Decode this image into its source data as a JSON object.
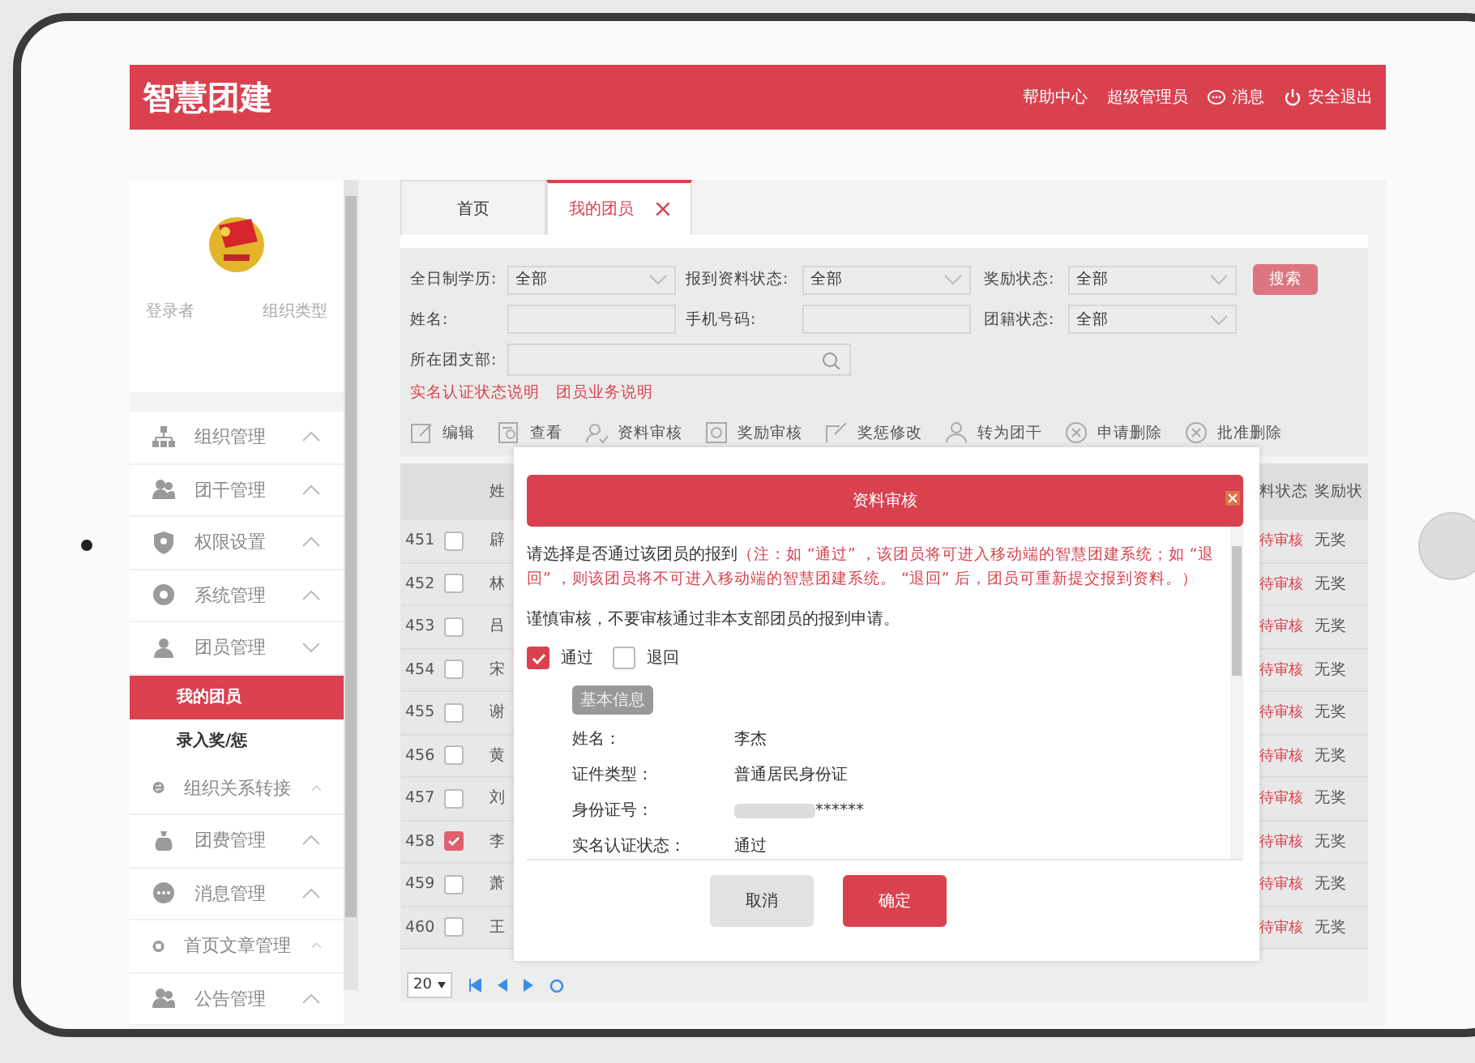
{
  "header": {
    "logo": "智慧团建",
    "links": [
      {
        "label": "帮助中心"
      },
      {
        "label": "超级管理员"
      },
      {
        "label": "消息"
      },
      {
        "label": "安全退出"
      }
    ]
  },
  "profile": {
    "user_label": "登录者",
    "org_label": "组织类型"
  },
  "sidebar": {
    "items": [
      {
        "label": "组织管理",
        "expanded": false
      },
      {
        "label": "团干管理",
        "expanded": false
      },
      {
        "label": "权限设置",
        "expanded": false
      },
      {
        "label": "系统管理",
        "expanded": false
      },
      {
        "label": "团员管理",
        "expanded": true,
        "children": [
          {
            "label": "我的团员",
            "selected": true
          },
          {
            "label": "录入奖/惩",
            "selected": false
          }
        ]
      },
      {
        "label": "组织关系转接",
        "expanded": false
      },
      {
        "label": "团费管理",
        "expanded": false
      },
      {
        "label": "消息管理",
        "expanded": false
      },
      {
        "label": "首页文章管理",
        "expanded": false
      },
      {
        "label": "公告管理",
        "expanded": false
      }
    ]
  },
  "tabs": [
    {
      "label": "首页",
      "selected": false,
      "closable": false
    },
    {
      "label": "我的团员",
      "selected": true,
      "closable": true
    }
  ],
  "filters": [
    {
      "label": "全日制学历:",
      "kind": "select",
      "value": "全部"
    },
    {
      "label": "报到资料状态:",
      "kind": "select",
      "value": "全部"
    },
    {
      "label": "奖励状态:",
      "kind": "select",
      "value": "全部"
    },
    {
      "label": "姓名:",
      "kind": "input"
    },
    {
      "label": "手机号码:",
      "kind": "input"
    },
    {
      "label": "团籍状态:",
      "kind": "select",
      "value": "全部"
    },
    {
      "label": "所在团支部:",
      "kind": "search"
    }
  ],
  "search_button": "搜索",
  "help_links": [
    "实名认证状态说明",
    "团员业务说明"
  ],
  "toolbar": [
    "编辑",
    "查看",
    "资料审核",
    "奖励审核",
    "奖惩修改",
    "转为团干",
    "申请删除",
    "批准删除"
  ],
  "table": {
    "columns": [
      "姓",
      "料状态",
      "奖励状"
    ],
    "rows": [
      {
        "number": "451",
        "name": "辟",
        "status": "待审核",
        "award": "无奖",
        "checked": false
      },
      {
        "number": "452",
        "name": "林",
        "status": "待审核",
        "award": "无奖",
        "checked": false
      },
      {
        "number": "453",
        "name": "吕",
        "status": "待审核",
        "award": "无奖",
        "checked": false
      },
      {
        "number": "454",
        "name": "宋",
        "status": "待审核",
        "award": "无奖",
        "checked": false
      },
      {
        "number": "455",
        "name": "谢",
        "status": "待审核",
        "award": "无奖",
        "checked": false
      },
      {
        "number": "456",
        "name": "黄",
        "status": "待审核",
        "award": "无奖",
        "checked": false
      },
      {
        "number": "457",
        "name": "刘",
        "status": "待审核",
        "award": "无奖",
        "checked": false
      },
      {
        "number": "458",
        "name": "李",
        "status": "待审核",
        "award": "无奖",
        "checked": true
      },
      {
        "number": "459",
        "name": "萧",
        "status": "待审核",
        "award": "无奖",
        "checked": false
      },
      {
        "number": "460",
        "name": "王",
        "status": "待审核",
        "award": "无奖",
        "checked": false
      }
    ]
  },
  "pager": {
    "page_size": "20"
  },
  "dialog": {
    "title": "资料审核",
    "prompt": "请选择是否通过该团员的报到",
    "note": "（注：如 “通过” ，该团员将可进入移动端的智慧团建系统；如 “退回” ，则该团员将不可进入移动端的智慧团建系统。 “退回” 后，团员可重新提交报到资料。）",
    "warning": "谨慎审核，不要审核通过非本支部团员的报到申请。",
    "options": [
      {
        "label": "通过",
        "checked": true
      },
      {
        "label": "退回",
        "checked": false
      }
    ],
    "section": "基本信息",
    "fields": [
      {
        "label": "姓名：",
        "value": "李杰",
        "masked": false
      },
      {
        "label": "证件类型：",
        "value": "普通居民身份证",
        "masked": false
      },
      {
        "label": "身份证号：",
        "value": "******",
        "masked": true
      },
      {
        "label": "实名认证状态：",
        "value": "通过",
        "masked": false
      }
    ],
    "buttons": [
      {
        "label": "取消",
        "kind": "secondary"
      },
      {
        "label": "确定",
        "kind": "primary"
      }
    ]
  }
}
